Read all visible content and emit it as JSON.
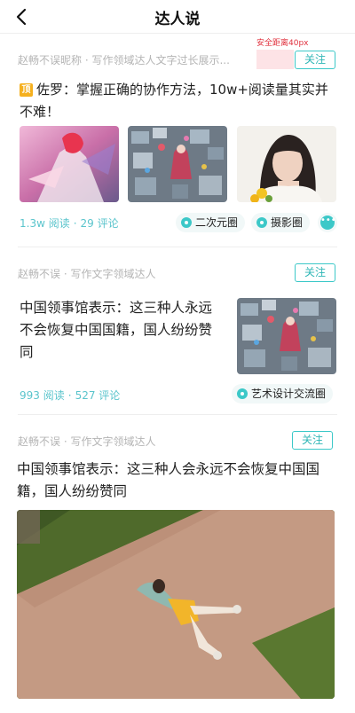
{
  "nav": {
    "title": "达人说",
    "back_icon": "back-arrow-icon"
  },
  "safe_note": "安全距离40px",
  "posts": [
    {
      "author": "赵畅不误昵称 · 写作领域达人文字过长展示...",
      "follow": "关注",
      "badge": "顶",
      "title": "佐罗：掌握正确的协作方法，10w+阅读量其实并不难！",
      "reads": "1.3w 阅读",
      "comments": "29 评论",
      "tags": [
        "二次元圈",
        "摄影圈"
      ],
      "more_icon": "more-dots-icon"
    },
    {
      "author": "赵畅不误 · 写作文字领域达人",
      "follow": "关注",
      "title": "中国领事馆表示：这三种人永远不会恢复中国国籍，国人纷纷赞同",
      "reads": "993 阅读",
      "comments": "527 评论",
      "tags": [
        "艺术设计交流圈"
      ]
    },
    {
      "author": "赵畅不误 · 写作文字领域达人",
      "follow": "关注",
      "title": "中国领事馆表示：这三种人会永远不会恢复中国国籍，国人纷纷赞同"
    }
  ],
  "colors": {
    "accent": "#3cc8c8",
    "stats": "#5ac4cc",
    "badge": "#f5b01e",
    "safe_zone": "#fde3e6"
  }
}
